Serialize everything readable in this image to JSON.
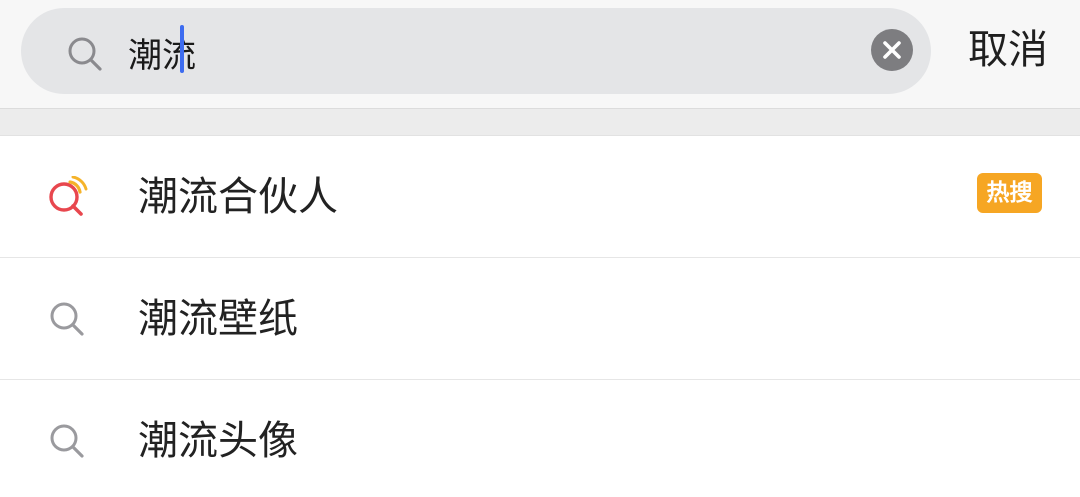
{
  "search": {
    "query": "潮流",
    "cancel_label": "取消"
  },
  "suggestions": [
    {
      "label": "潮流合伙人",
      "icon": "hot-search-icon",
      "badge": "热搜"
    },
    {
      "label": "潮流壁纸",
      "icon": "search-icon"
    },
    {
      "label": "潮流头像",
      "icon": "search-icon"
    }
  ],
  "colors": {
    "search_bg": "#e4e5e7",
    "caret": "#3d6cf0",
    "hot_icon_red": "#e8474e",
    "hot_icon_yellow": "#f5b32a",
    "badge_bg": "#f6a623"
  }
}
